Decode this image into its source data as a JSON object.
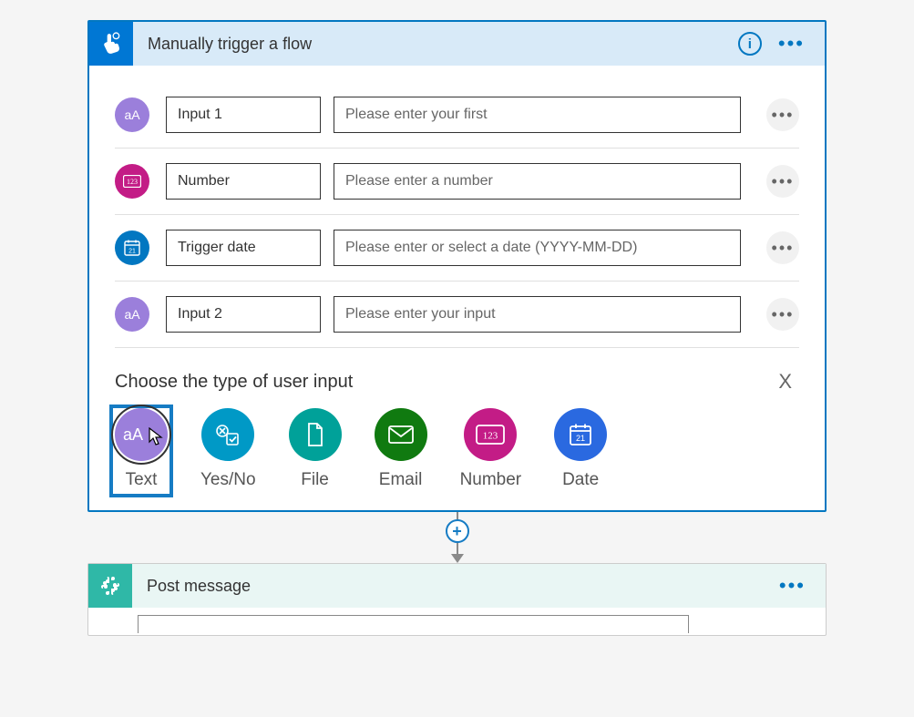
{
  "trigger": {
    "title": "Manually trigger a flow",
    "inputs": [
      {
        "iconKind": "text",
        "name": "Input 1",
        "placeholder": "Please enter your first"
      },
      {
        "iconKind": "number",
        "name": "Number",
        "placeholder": "Please enter a number"
      },
      {
        "iconKind": "date",
        "name": "Trigger date",
        "placeholder": "Please enter or select a date (YYYY-MM-DD)"
      },
      {
        "iconKind": "text",
        "name": "Input 2",
        "placeholder": "Please enter your input"
      }
    ],
    "picker": {
      "title": "Choose the type of user input",
      "close": "X",
      "options": [
        {
          "key": "text",
          "label": "Text",
          "selected": true
        },
        {
          "key": "yesno",
          "label": "Yes/No",
          "selected": false
        },
        {
          "key": "file",
          "label": "File",
          "selected": false
        },
        {
          "key": "email",
          "label": "Email",
          "selected": false
        },
        {
          "key": "number",
          "label": "Number",
          "selected": false
        },
        {
          "key": "date",
          "label": "Date",
          "selected": false
        }
      ]
    }
  },
  "postAction": {
    "title": "Post message"
  }
}
